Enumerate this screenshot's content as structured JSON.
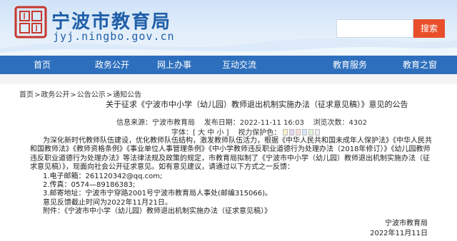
{
  "header": {
    "logo_emblem": "宁波市教育局",
    "site_title": "宁波市教育局",
    "site_domain": "jyj.ningbo.gov.cn",
    "search_placeholder": "",
    "search_button": "搜索",
    "colors": {
      "brand_blue": "#1f5fa8",
      "nav_blue": "#2d6fbd",
      "search_red": "#e94e2b"
    }
  },
  "nav": {
    "items": [
      {
        "label": "首页"
      },
      {
        "label": "政务公开"
      },
      {
        "label": "网上办事"
      },
      {
        "label": "互动交流"
      },
      {
        "label": ""
      },
      {
        "label": "教育服务"
      },
      {
        "label": "教育之窗"
      }
    ]
  },
  "breadcrumb": [
    "首页",
    "政务公开",
    "公告公示",
    "通知公告"
  ],
  "article": {
    "title": "关于征求《宁波市中小学（幼儿园）教师退出机制实施办法（征求意见稿）》意见的公告",
    "source_label": "信息来源：宁波市教育局",
    "publish_label": "发布日期：2022-11-11 16:03",
    "views_label": "浏览次数：4302",
    "font_label": "字体：[ 大  中  小 ]",
    "eye_label": "视力保护色：",
    "eye_colors": [
      "#f5f0c8",
      "#e3d6f5",
      "#f9dede",
      "#d6e6f7",
      "#dff5d9",
      "#eeeeee"
    ],
    "body": [
      "为深化新时代教师队伍建设，优化教师队伍结构，激发教师队伍活力，根据《中华人民共和国未成年人保护法》《中华人民共和国教师法》《教师资格条例》《事业单位人事管理条例》《中小学教师违反职业道德行为处理办法（2018年修订）》《幼儿园教师违反职业道德行为处理办法》等法律法规及政策的规定，市教育局拟制了《宁波市中小学（幼儿园）教师退出机制实施办法（征求意见稿）》，现面向社会公开征求意见。如有意见建议，请通过以下方式之一反馈：",
      "1.电子邮箱：261120342@qq.com;",
      "2.传真：0574—89186383;",
      "3.邮寄地址：宁波市宁穿路2001号宁波市教育局人事处(邮编315066)。",
      "意见反馈截止时间为2022年11月21日。",
      "附件：《宁波市中小学（幼儿园）教师退出机制实施办法（征求意见稿）》"
    ],
    "signature": "宁波市教育局",
    "signature_date": "2022年11月11日"
  }
}
